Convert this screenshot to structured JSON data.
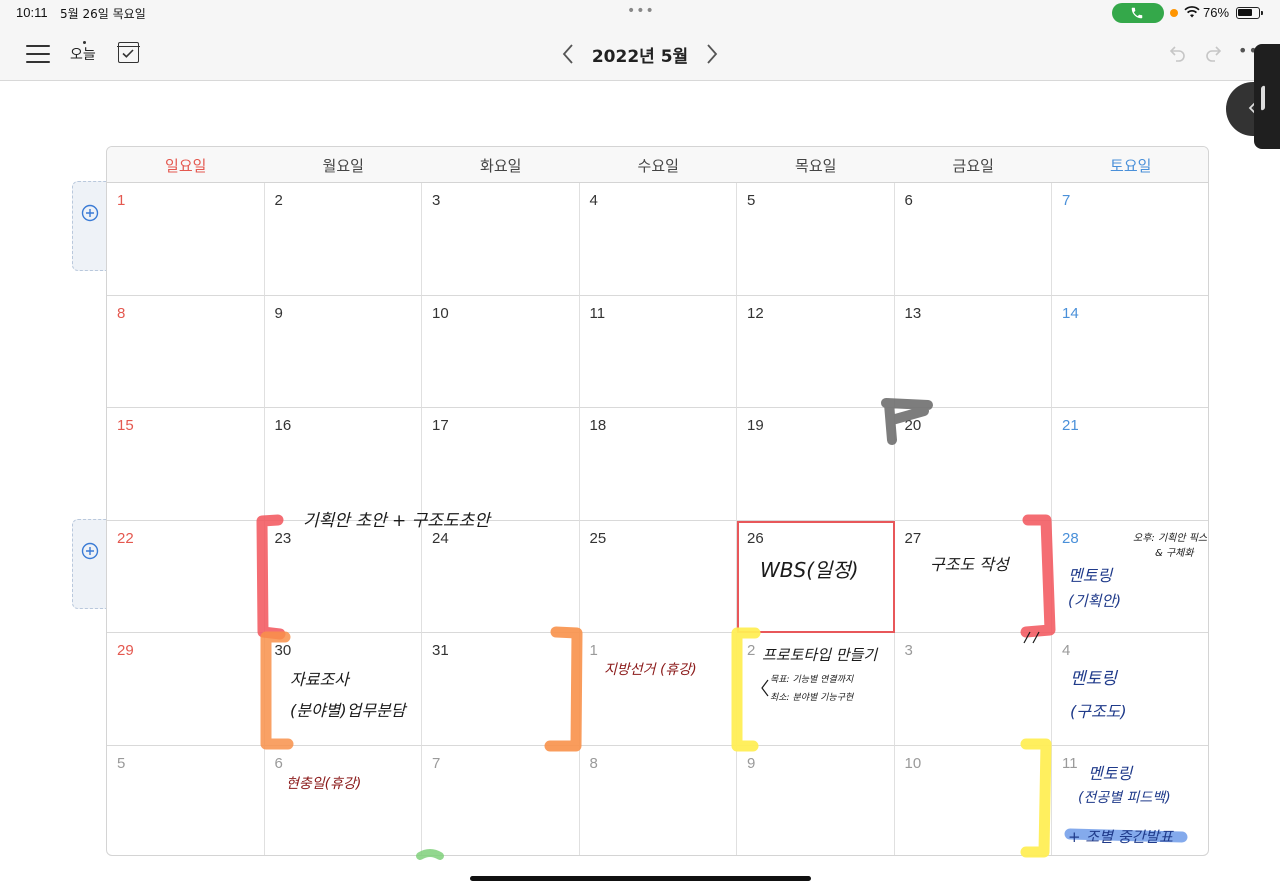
{
  "status_bar": {
    "time": "10:11",
    "date": "5월 26일 목요일",
    "battery": "76%",
    "battery_level": 0.76
  },
  "toolbar": {
    "today_label": "오늘",
    "month_title": "2022년 5월"
  },
  "weekdays": [
    "일요일",
    "월요일",
    "화요일",
    "수요일",
    "목요일",
    "금요일",
    "토요일"
  ],
  "weeks": [
    [
      "1",
      "2",
      "3",
      "4",
      "5",
      "6",
      "7"
    ],
    [
      "8",
      "9",
      "10",
      "11",
      "12",
      "13",
      "14"
    ],
    [
      "15",
      "16",
      "17",
      "18",
      "19",
      "20",
      "21"
    ],
    [
      "22",
      "23",
      "24",
      "25",
      "26",
      "27",
      "28"
    ],
    [
      "29",
      "30",
      "31",
      "1",
      "2",
      "3",
      "4"
    ],
    [
      "5",
      "6",
      "7",
      "8",
      "9",
      "10",
      "11"
    ]
  ],
  "notes": {
    "plan_draft": "기획안 초안 + 구조도초안",
    "wbs": "WBS(일정)",
    "structure": "구조도 작성",
    "mentoring_plan_a": "멘토링",
    "mentoring_plan_b": "(기획안)",
    "sat28_line1": "오후: 기획안 픽스",
    "sat28_line2": "& 구체화",
    "research_a": "자료조사",
    "research_b": "(분야별)업무분담",
    "election": "지방선거 (휴강)",
    "prototype": "프로토타입 만들기",
    "prototype_goal": "목표: 기능별 연결까지",
    "prototype_min": "최소: 분야별 기능구현",
    "mentoring_struct_a": "멘토링",
    "mentoring_struct_b": "(구조도)",
    "memorial": "현충일(휴강)",
    "mentoring_feedback_a": "멘토링",
    "mentoring_feedback_b": "(전공별 피드백)",
    "mid_presentation": "+ 조별 중간발표"
  },
  "colors": {
    "sunday": "#e4584f",
    "saturday": "#4a90d9",
    "today_outline": "#e8575a",
    "ink_black": "#1a1a1a",
    "ink_dark_red": "#8b1a1a",
    "ink_navy": "#1f3a8a",
    "marker_red": "#f2545b",
    "marker_orange": "#f8914a",
    "marker_yellow": "#ffee55",
    "marker_gray": "#6f6f6f",
    "marker_blue": "#5b8ee6",
    "marker_green": "#7fd07a"
  }
}
